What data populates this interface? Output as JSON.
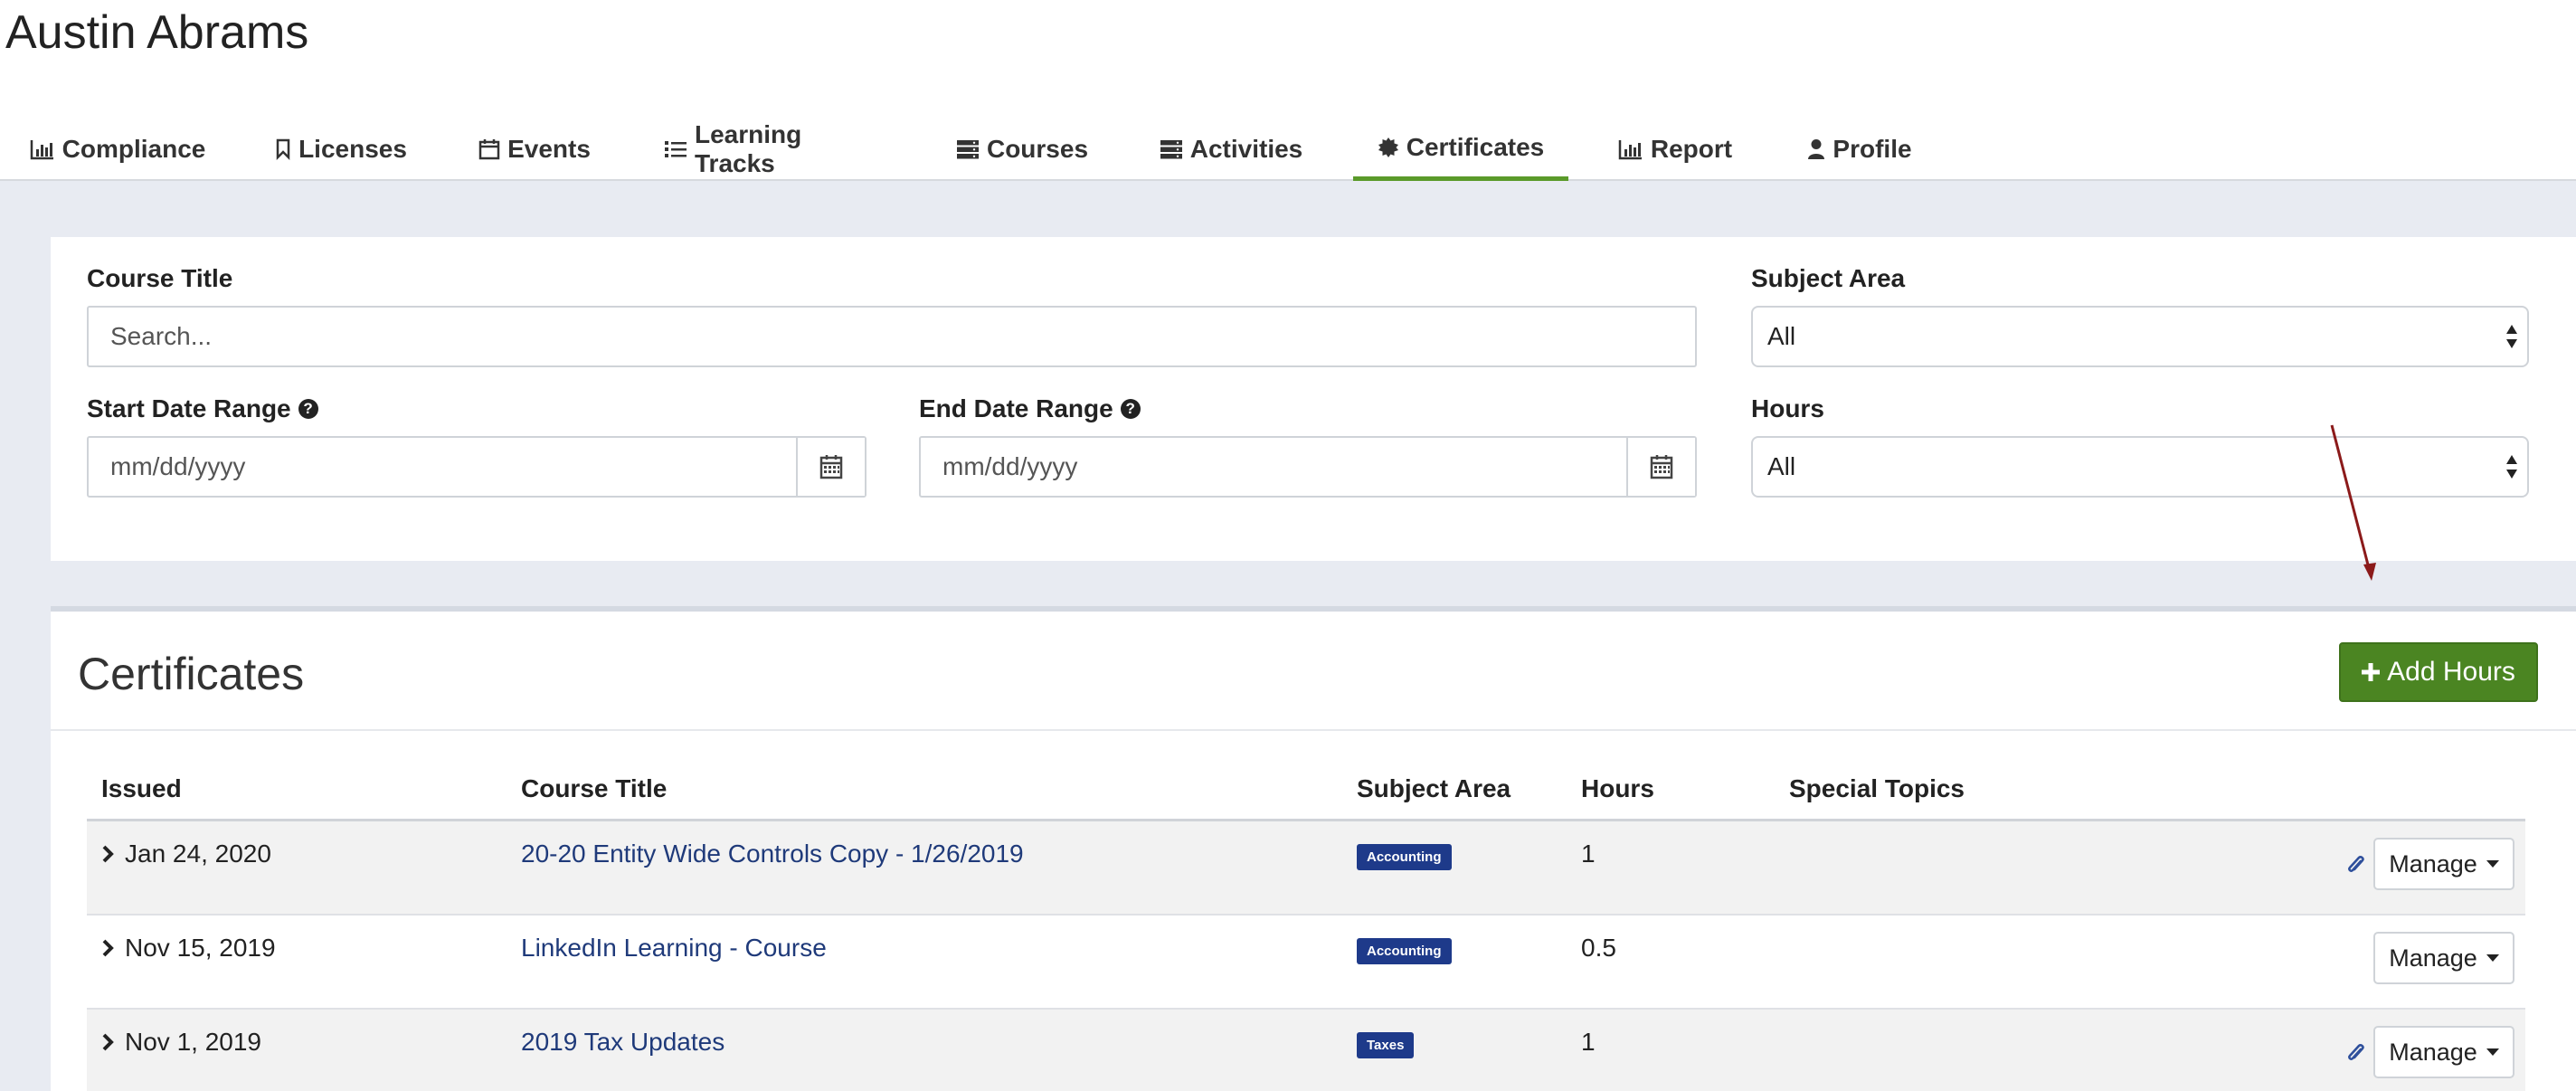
{
  "app": {
    "title": "Austin Abrams"
  },
  "nav": {
    "items": [
      {
        "label": "Compliance",
        "icon": "bar-chart-icon"
      },
      {
        "label": "Licenses",
        "icon": "bookmark-icon"
      },
      {
        "label": "Events",
        "icon": "calendar-icon"
      },
      {
        "label": "Learning Tracks",
        "icon": "list-icon"
      },
      {
        "label": "Courses",
        "icon": "server-icon"
      },
      {
        "label": "Activities",
        "icon": "server-icon"
      },
      {
        "label": "Certificates",
        "icon": "certificate-icon",
        "active": true
      },
      {
        "label": "Report",
        "icon": "bar-chart-icon"
      },
      {
        "label": "Profile",
        "icon": "user-icon"
      }
    ]
  },
  "filters": {
    "course_title": {
      "label": "Course Title",
      "placeholder": "Search..."
    },
    "subject_area": {
      "label": "Subject Area",
      "value": "All"
    },
    "start_date": {
      "label": "Start Date Range",
      "placeholder": "mm/dd/yyyy"
    },
    "end_date": {
      "label": "End Date Range",
      "placeholder": "mm/dd/yyyy"
    },
    "hours": {
      "label": "Hours",
      "value": "All"
    }
  },
  "certificates": {
    "title": "Certificates",
    "add_button": "Add Hours",
    "columns": {
      "issued": "Issued",
      "course_title": "Course Title",
      "subject_area": "Subject Area",
      "hours": "Hours",
      "special_topics": "Special Topics"
    },
    "rows": [
      {
        "issued": "Jan 24, 2020",
        "course_title": "20-20 Entity Wide Controls Copy - 1/26/2019",
        "subject_area": "Accounting",
        "hours": "1",
        "special_topics": "",
        "has_attachment": true,
        "manage": "Manage"
      },
      {
        "issued": "Nov 15, 2019",
        "course_title": "LinkedIn Learning - Course",
        "subject_area": "Accounting",
        "hours": "0.5",
        "special_topics": "",
        "has_attachment": false,
        "manage": "Manage"
      },
      {
        "issued": "Nov 1, 2019",
        "course_title": "2019 Tax Updates",
        "subject_area": "Taxes",
        "hours": "1",
        "special_topics": "",
        "has_attachment": true,
        "manage": "Manage"
      }
    ]
  },
  "colors": {
    "accent_green": "#4b8522",
    "link_blue": "#1f3a7a",
    "badge_blue": "#1e3a8a",
    "annotation_arrow": "#8b1a1a",
    "page_gray": "#e8ebf2"
  }
}
